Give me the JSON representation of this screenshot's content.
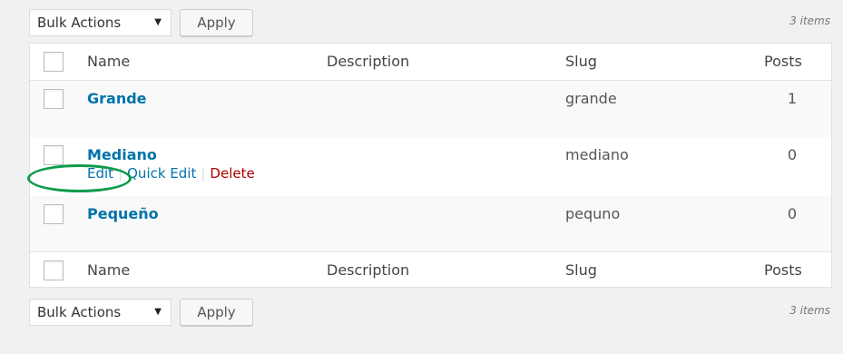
{
  "top_nav": {
    "bulk_actions_label": "Bulk Actions",
    "apply_label": "Apply",
    "item_count": "3 items"
  },
  "bottom_nav": {
    "bulk_actions_label": "Bulk Actions",
    "apply_label": "Apply",
    "item_count": "3 items"
  },
  "table": {
    "columns": [
      "Name",
      "Description",
      "Slug",
      "Posts"
    ],
    "rows": [
      {
        "name": "Grande",
        "description": "",
        "slug": "grande",
        "posts": "1"
      },
      {
        "name": "Mediano",
        "description": "",
        "slug": "mediano",
        "posts": "0",
        "row_actions": {
          "edit": "Edit",
          "quick_edit": "Quick Edit",
          "delete": "Delete",
          "separator": "|"
        }
      },
      {
        "name": "Pequeño",
        "description": "",
        "slug": "pequno",
        "posts": "0"
      }
    ],
    "footer_columns": [
      "Name",
      "Description",
      "Slug",
      "Posts"
    ]
  },
  "icons": {
    "dropdown_caret": "caret-down-icon"
  },
  "colors": {
    "link": "#0073aa",
    "delete": "#aa0000",
    "highlight": "#0d9b4b",
    "background": "#f1f1f1",
    "alt_row": "#f9f9f9"
  }
}
